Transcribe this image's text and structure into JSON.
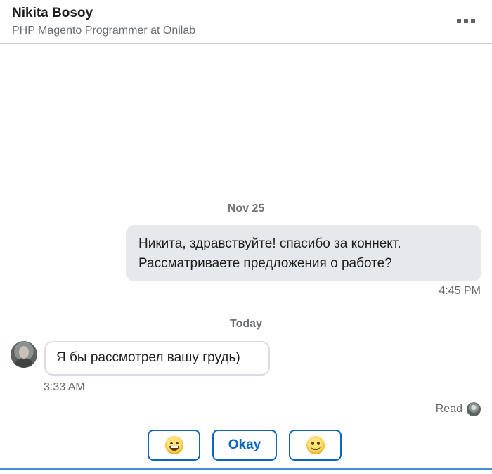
{
  "header": {
    "name": "Nikita Bosoy",
    "headline": "PHP Magento Programmer at Onilab",
    "more_icon": "more-dots-icon"
  },
  "conversation": {
    "groups": [
      {
        "date": "Nov 25",
        "messages": [
          {
            "direction": "outgoing",
            "lines": [
              "Никита, здравствуйте! спасибо за коннект.",
              "Рассматриваете предложения о работе?"
            ],
            "time": "4:45 PM"
          }
        ]
      },
      {
        "date": "Today",
        "messages": [
          {
            "direction": "incoming",
            "text": "Я бы рассмотрел вашу грудь)",
            "time": "3:33 AM",
            "avatar": "avatar"
          }
        ]
      }
    ],
    "read_receipt": "Read"
  },
  "quick_replies": [
    {
      "emoji": "grinning-face-icon"
    },
    {
      "label": "Okay"
    },
    {
      "emoji": "smiling-face-icon"
    }
  ],
  "colors": {
    "accent": "#0a66c2",
    "outgoing_bubble": "#e5e9ed",
    "composer_line": "#4a90d9"
  }
}
